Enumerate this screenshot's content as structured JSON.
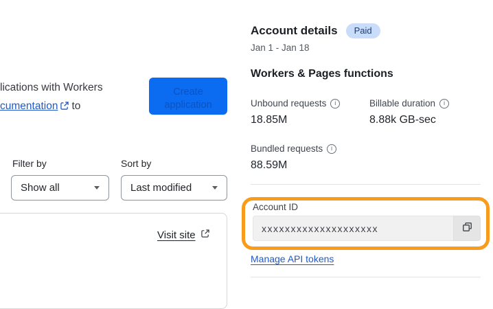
{
  "colors": {
    "accent_blue": "#0b6cf1",
    "button_text_blue": "#0c53c2",
    "link_blue": "#2159c4",
    "badge_bg": "#c9dcf9",
    "badge_text": "#1d4073",
    "highlight_orange": "#f79c1d"
  },
  "left_panel": {
    "intro": {
      "line1": "lications with Workers",
      "link_text": "cumentation",
      "after_link": "to"
    },
    "create_button": {
      "label_line1": "Create",
      "label_line2": "application"
    },
    "filter": {
      "label": "Filter by",
      "value": "Show all"
    },
    "sort": {
      "label": "Sort by",
      "value": "Last modified"
    },
    "project_card": {
      "visit_site_label": "Visit site"
    }
  },
  "account_panel": {
    "title": "Account details",
    "plan_badge": "Paid",
    "date_range": "Jan 1 - Jan 18",
    "functions_title": "Workers & Pages functions",
    "stats": [
      {
        "label": "Unbound requests",
        "value": "18.85M"
      },
      {
        "label": "Billable duration",
        "value": "8.88k GB-sec"
      },
      {
        "label": "Bundled requests",
        "value": "88.59M"
      }
    ],
    "account_id": {
      "label": "Account ID",
      "value": "xxxxxxxxxxxxxxxxxxxx"
    },
    "manage_api_tokens_label": "Manage API tokens"
  },
  "icons": {
    "info_glyph": "i"
  }
}
